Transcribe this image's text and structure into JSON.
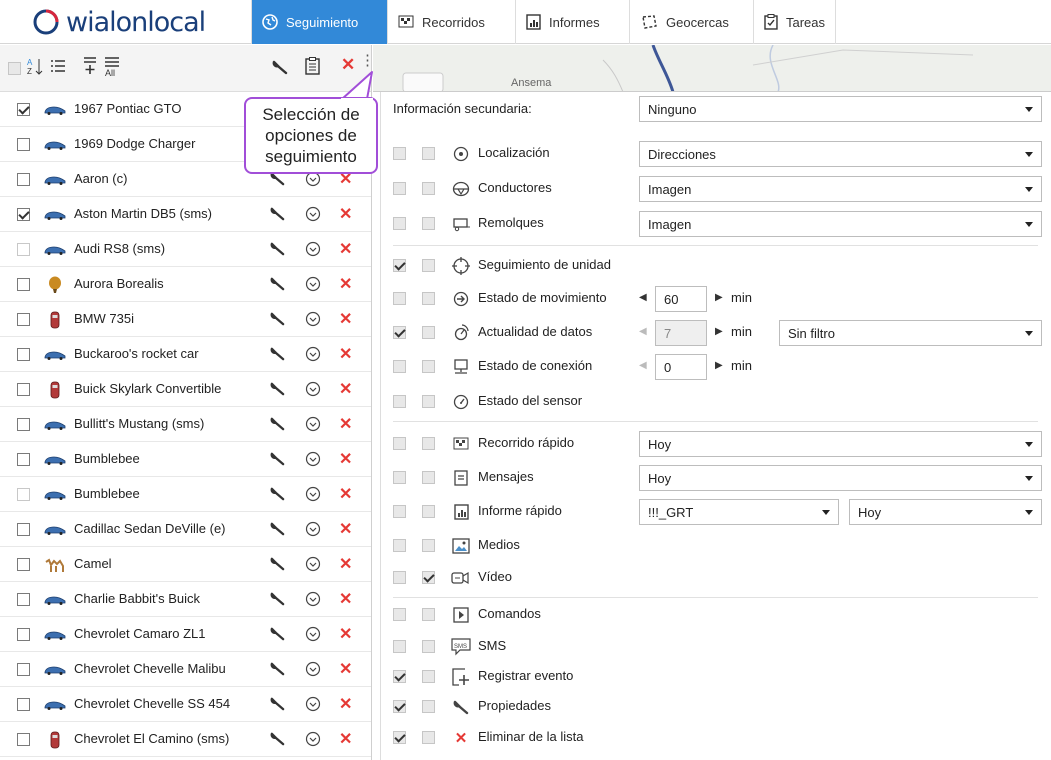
{
  "app": {
    "logo_text": "wialonlocal",
    "tabs": [
      {
        "label": "Seguimiento",
        "icon": "globe-icon",
        "active": true
      },
      {
        "label": "Recorridos",
        "icon": "checkered-flag-icon"
      },
      {
        "label": "Informes",
        "icon": "report-chart-icon"
      },
      {
        "label": "Geocercas",
        "icon": "geofence-icon"
      },
      {
        "label": "Tareas",
        "icon": "task-check-icon"
      }
    ]
  },
  "toolbar": {
    "sort_label": "A Z",
    "all_label": "All",
    "map_label": "Ansema"
  },
  "callout": {
    "text": "Selección de opciones de seguimiento"
  },
  "units": [
    {
      "name": "1967 Pontiac GTO",
      "checked": true,
      "icon": "car-icon"
    },
    {
      "name": "1969 Dodge Charger",
      "checked": false,
      "icon": "car-icon"
    },
    {
      "name": "Aaron (c)",
      "checked": false,
      "icon": "car-icon"
    },
    {
      "name": "Aston Martin DB5 (sms)",
      "checked": true,
      "icon": "car-icon"
    },
    {
      "name": "Audi RS8 (sms)",
      "checked": false,
      "icon": "car-icon",
      "disabled": true
    },
    {
      "name": "Aurora Borealis",
      "checked": false,
      "icon": "balloon-icon"
    },
    {
      "name": "BMW 735i",
      "checked": false,
      "icon": "car-top-icon"
    },
    {
      "name": "Buckaroo's rocket car",
      "checked": false,
      "icon": "car-icon"
    },
    {
      "name": "Buick Skylark Convertible",
      "checked": false,
      "icon": "car-top-icon"
    },
    {
      "name": "Bullitt's Mustang (sms)",
      "checked": false,
      "icon": "car-icon"
    },
    {
      "name": "Bumblebee",
      "checked": false,
      "icon": "car-icon"
    },
    {
      "name": "Bumblebee",
      "checked": false,
      "icon": "car-icon",
      "disabled": true
    },
    {
      "name": "Cadillac Sedan DeVille (e)",
      "checked": false,
      "icon": "car-icon"
    },
    {
      "name": "Camel",
      "checked": false,
      "icon": "camel-icon"
    },
    {
      "name": "Charlie Babbit's Buick",
      "checked": false,
      "icon": "car-icon"
    },
    {
      "name": "Chevrolet Camaro ZL1",
      "checked": false,
      "icon": "car-icon"
    },
    {
      "name": "Chevrolet Chevelle Malibu",
      "checked": false,
      "icon": "car-icon"
    },
    {
      "name": "Chevrolet Chevelle SS 454",
      "checked": false,
      "icon": "car-icon"
    },
    {
      "name": "Chevrolet El Camino (sms)",
      "checked": false,
      "icon": "car-top-icon"
    }
  ],
  "options": {
    "secondary_info": {
      "label": "Información secundaria:",
      "value": "Ninguno"
    },
    "localizacion": {
      "label": "Localización",
      "value": "Direcciones"
    },
    "conductores": {
      "label": "Conductores",
      "value": "Imagen"
    },
    "remolques": {
      "label": "Remolques",
      "value": "Imagen"
    },
    "seguimiento": {
      "label": "Seguimiento de unidad"
    },
    "movimiento": {
      "label": "Estado de movimiento",
      "value": "60",
      "unit": "min"
    },
    "actualidad": {
      "label": "Actualidad de datos",
      "value": "7",
      "unit": "min",
      "filter": "Sin filtro"
    },
    "conexion": {
      "label": "Estado de conexión",
      "value": "0",
      "unit": "min"
    },
    "sensor": {
      "label": "Estado del sensor"
    },
    "recorrido": {
      "label": "Recorrido rápido",
      "value": "Hoy"
    },
    "mensajes": {
      "label": "Mensajes",
      "value": "Hoy"
    },
    "informe": {
      "label": "Informe rápido",
      "value": "!!!_GRT",
      "period": "Hoy"
    },
    "medios": {
      "label": "Medios"
    },
    "video": {
      "label": "Vídeo"
    },
    "comandos": {
      "label": "Comandos"
    },
    "sms": {
      "label": "SMS"
    },
    "evento": {
      "label": "Registrar evento"
    },
    "propiedades": {
      "label": "Propiedades"
    },
    "eliminar": {
      "label": "Eliminar de la lista"
    }
  },
  "colors": {
    "accent": "#3289d8",
    "callout": "#a14ed8",
    "delete": "#e53935",
    "logo": "#1a3f7a"
  }
}
